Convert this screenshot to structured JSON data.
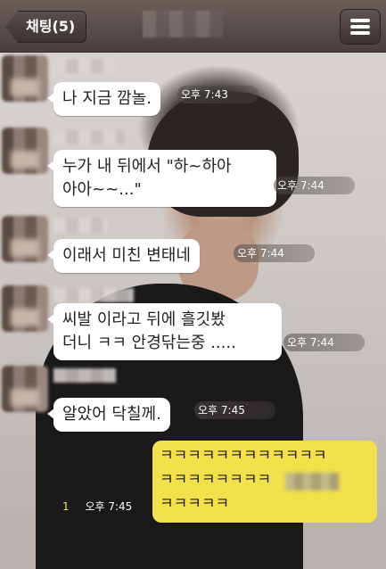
{
  "header": {
    "back_label": "채팅(5)",
    "menu_icon": "hamburger-menu-icon"
  },
  "messages": [
    {
      "text": "나 지금 깜놀.",
      "time": "오후 7:43"
    },
    {
      "text": "누가 내 뒤에서 \"하~하아\n아아~~...\"",
      "time": "오후 7:44"
    },
    {
      "text": "이래서 미친 변태네",
      "time": "오후 7:44"
    },
    {
      "text": "씨발 이라고 뒤에 흘깃봤\n더니 ㅋㅋ 안경닦는중 .....",
      "time": "오후 7:44"
    },
    {
      "text": "알았어 닥칠께.",
      "time": "오후 7:45"
    }
  ],
  "my_message": {
    "text": "ㅋㅋㅋㅋㅋㅋㅋㅋㅋㅋㅋㅋ\nㅋㅋㅋㅋㅋㅋㅋㅋ\nㅋㅋㅋㅋㅋ",
    "read_count": "1",
    "time": "오후 7:45"
  },
  "colors": {
    "header": "#4a3f3d",
    "my_bubble": "#f3e14c",
    "other_bubble": "#ffffff"
  }
}
